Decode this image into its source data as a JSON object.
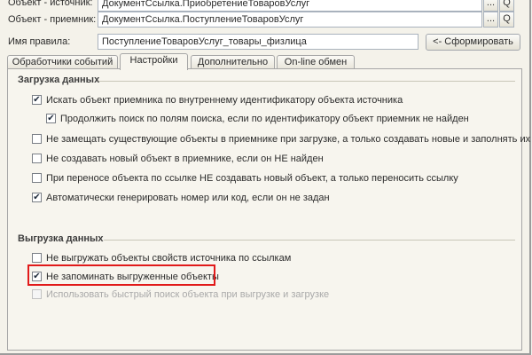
{
  "header": {
    "source_label": "Объект - источник:",
    "source_value": "ДокументСсылка.ПриобретениеТоваровУслуг",
    "receiver_label": "Объект - приемник:",
    "receiver_value": "ДокументСсылка.ПоступлениеТоваровУслуг",
    "rule_name_label": "Имя правила:",
    "rule_name_value": "ПоступлениеТоваровУслуг_товары_физлица",
    "generate_button": "<- Сформировать",
    "select_glyph": "...",
    "open_glyph": "Q"
  },
  "tabs": [
    {
      "label": "Обработчики событий",
      "active": false
    },
    {
      "label": "Настройки",
      "active": true
    },
    {
      "label": "Дополнительно",
      "active": false
    },
    {
      "label": "On-line обмен",
      "active": false
    }
  ],
  "load_section": {
    "title": "Загрузка данных",
    "options": [
      {
        "label": "Искать объект приемника по внутреннему идентификатору объекта источника",
        "checked": true
      },
      {
        "label": "Продолжить поиск по полям поиска, если по идентификатору объект приемник не найден",
        "checked": true
      },
      {
        "label": "Не замещать существующие объекты в приемнике при загрузке, а только создавать новые и заполнять их",
        "checked": false
      },
      {
        "label": "Не создавать новый объект в приемнике, если он НЕ найден",
        "checked": false
      },
      {
        "label": "При переносе объекта по ссылке НЕ создавать новый объект, а только переносить ссылку",
        "checked": false
      },
      {
        "label": "Автоматически генерировать номер или код, если он не задан",
        "checked": true
      }
    ]
  },
  "export_section": {
    "title": "Выгрузка данных",
    "options": [
      {
        "label": "Не выгружать объекты свойств источника по ссылкам",
        "checked": false
      },
      {
        "label": "Не запоминать выгруженные объекты",
        "checked": true,
        "highlighted": true
      },
      {
        "label": "Использовать быстрый поиск объекта при выгрузке и загрузке",
        "checked": false,
        "disabled": true
      }
    ]
  },
  "colors": {
    "highlight_border": "#e11a1a",
    "panel_background": "#f7f5ee"
  },
  "check_glyph": "✔"
}
